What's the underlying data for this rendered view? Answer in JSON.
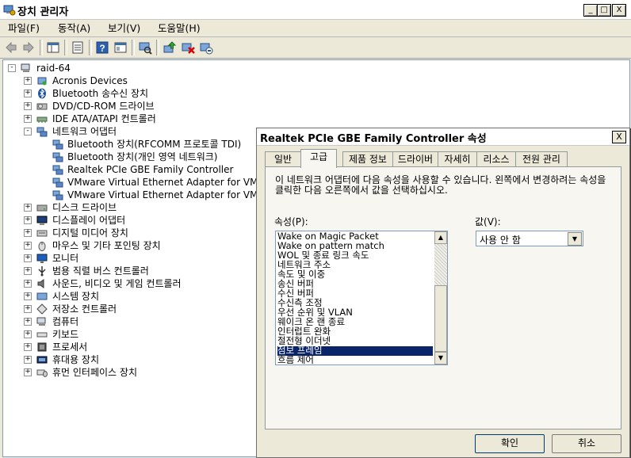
{
  "window": {
    "title": "장치 관리자",
    "minimize": "_",
    "maximize": "□",
    "close": "X"
  },
  "menu": [
    {
      "label": "파일(F)"
    },
    {
      "label": "동작(A)"
    },
    {
      "label": "보기(V)"
    },
    {
      "label": "도움말(H)"
    }
  ],
  "toolbar": [
    "back-icon",
    "forward-icon",
    "up-view-icon",
    "properties-icon",
    "help-icon",
    "view-icon",
    "scan-hardware-icon",
    "update-driver-icon",
    "uninstall-icon",
    "disable-icon"
  ],
  "tree": {
    "root": "raid-64",
    "categories": [
      {
        "label": "Acronis Devices",
        "expander": "+"
      },
      {
        "label": "Bluetooth 송수신 장치",
        "expander": "+"
      },
      {
        "label": "DVD/CD-ROM 드라이브",
        "expander": "+"
      },
      {
        "label": "IDE ATA/ATAPI 컨트롤러",
        "expander": "+"
      },
      {
        "label": "네트워크 어댑터",
        "expander": "-"
      },
      {
        "label": "디스크 드라이브",
        "expander": "+"
      },
      {
        "label": "디스플레이 어댑터",
        "expander": "+"
      },
      {
        "label": "디지털 미디어 장치",
        "expander": "+"
      },
      {
        "label": "마우스 및 기타 포인팅 장치",
        "expander": "+"
      },
      {
        "label": "모니터",
        "expander": "+"
      },
      {
        "label": "범용 직렬 버스 컨트롤러",
        "expander": "+"
      },
      {
        "label": "사운드, 비디오 및 게임 컨트롤러",
        "expander": "+"
      },
      {
        "label": "시스템 장치",
        "expander": "+"
      },
      {
        "label": "저장소 컨트롤러",
        "expander": "+"
      },
      {
        "label": "컴퓨터",
        "expander": "+"
      },
      {
        "label": "키보드",
        "expander": "+"
      },
      {
        "label": "프로세서",
        "expander": "+"
      },
      {
        "label": "휴대용 장치",
        "expander": "+"
      },
      {
        "label": "휴먼 인터페이스 장치",
        "expander": "+"
      }
    ],
    "network_children": [
      {
        "label": "Bluetooth 장치(RFCOMM 프로토콜 TDI)"
      },
      {
        "label": "Bluetooth 장치(개인 영역 네트워크)"
      },
      {
        "label": "Realtek PCIe GBE Family Controller"
      },
      {
        "label": "VMware Virtual Ethernet Adapter for VMne"
      },
      {
        "label": "VMware Virtual Ethernet Adapter for VMne"
      }
    ]
  },
  "dialog": {
    "title": "Realtek PCIe GBE Family Controller 속성",
    "close": "X",
    "tabs": [
      {
        "label": "일반"
      },
      {
        "label": "고급"
      },
      {
        "label": "제품 정보"
      },
      {
        "label": "드라이버"
      },
      {
        "label": "자세히"
      },
      {
        "label": "리소스"
      },
      {
        "label": "전원 관리"
      }
    ],
    "active_tab": "고급",
    "description": "이 네트워크 어댑터에 다음 속성을 사용할 수 있습니다. 왼쪽에서 변경하려는 속성을 클릭한 다음 오른쪽에서 값을 선택하십시오.",
    "property_label": "속성(P):",
    "value_label": "값(V):",
    "properties": [
      "Wake on Magic Packet",
      "Wake on pattern match",
      "WOL 및 종료 링크 속도",
      "네트워크 주소",
      "속도 및 이중",
      "송신 버퍼",
      "수신 버퍼",
      "수신측 조정",
      "우선 순위 및 VLAN",
      "웨이크 온 랜 종료",
      "인터럽트 완화",
      "절전형 이더넷",
      "점보 프레임",
      "흐름 제어"
    ],
    "selected_property": "점보 프레임",
    "value": "사용 안 함",
    "ok": "확인",
    "cancel": "취소"
  }
}
